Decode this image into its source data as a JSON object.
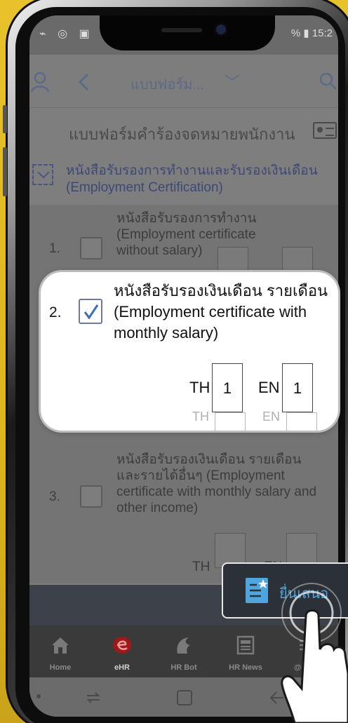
{
  "status_bar": {
    "left": "⌁ ◎ ▣ ·",
    "right": "% ▮ 15:2"
  },
  "app_bar": {
    "title": "แบบฟอร์ม...",
    "dropdown": "﹀"
  },
  "form": {
    "title": "แบบฟอร์มคำร้องจดหมายพนักงาน",
    "section_title": "หนังสือรับรองการทำงานและรับรองเงินเดือน (Employment Certification)",
    "items": [
      {
        "number": "1.",
        "text": "หนังสือรับรองการทำงาน (Employment certificate without salary)",
        "checked": false
      },
      {
        "number": "2.",
        "text": "หนังสือรับรองเงินเดือน รายเดือน (Employment certificate with monthly salary)",
        "checked": true,
        "th_label": "TH",
        "th_qty": "1",
        "en_label": "EN",
        "en_qty": "1"
      },
      {
        "number": "3.",
        "text": "หนังสือรับรองเงินเดือน รายเดือน และรายได้อื่นๆ (Employment certificate with monthly salary and other income)",
        "checked": false,
        "th_label": "TH",
        "en_label": "EN"
      }
    ]
  },
  "ghost_labels": {
    "th": "TH",
    "en": "EN"
  },
  "action": {
    "submit_label": "ยื่นเสนอ"
  },
  "bottom_nav": [
    {
      "label": "Home",
      "icon": "home-icon"
    },
    {
      "label": "eHR",
      "icon": "ehr-logo-icon"
    },
    {
      "label": "HR Bot",
      "icon": "bot-icon"
    },
    {
      "label": "HR News",
      "icon": "news-icon"
    },
    {
      "label": "@Bang",
      "icon": "menu-icon"
    }
  ],
  "colors": {
    "accent_blue": "#4fa6de",
    "ehr_red": "#c81e1e",
    "frame_yellow": "#dcb51f",
    "checkmark": "#3a6fb8"
  }
}
